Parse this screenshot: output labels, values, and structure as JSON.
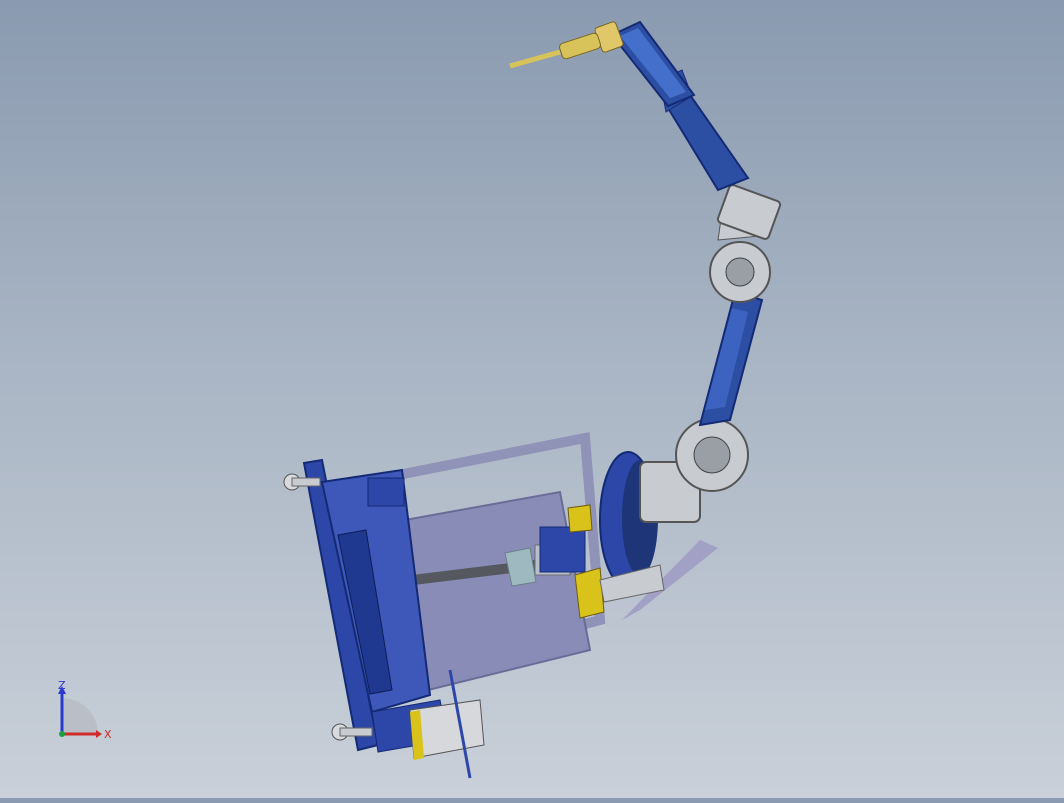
{
  "viewport": {
    "background_top": "#8a9ab0",
    "background_bottom": "#c9d0d9"
  },
  "model": {
    "robot_color": "#2d4fa3",
    "robot_dark": "#1e3577",
    "metal_color": "#c8cbd0",
    "frame_color": "#8f93b8",
    "plate_color": "#2c47a8",
    "accent_yellow": "#d9c21a",
    "torch_color": "#d8c35a"
  },
  "triad": {
    "z_label": "Z",
    "x_label": "X",
    "z_color": "#2a3ad0",
    "x_color": "#d02a2a",
    "y_color": "#1aa03a"
  }
}
